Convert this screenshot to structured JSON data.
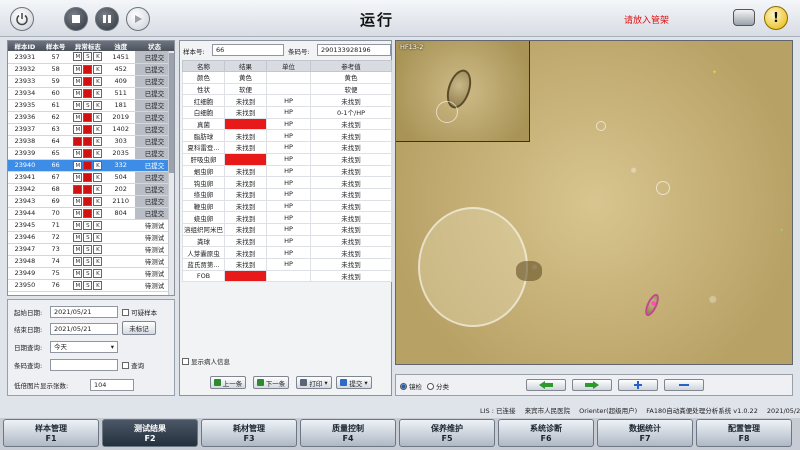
{
  "header": {
    "title": "运行",
    "alert": "请放入管架"
  },
  "samples": {
    "columns": [
      "样本ID",
      "样本号",
      "异常标志",
      "浊度",
      "状态"
    ],
    "rows": [
      {
        "id": "23931",
        "no": "57",
        "flags": [
          "M",
          "S",
          "K"
        ],
        "red": [],
        "turbidity": "1451",
        "status": "已提交"
      },
      {
        "id": "23932",
        "no": "58",
        "flags": [
          "M",
          "S",
          "K"
        ],
        "red": [
          1
        ],
        "turbidity": "452",
        "status": "已提交"
      },
      {
        "id": "23933",
        "no": "59",
        "flags": [
          "M",
          "S",
          "K"
        ],
        "red": [
          1
        ],
        "turbidity": "409",
        "status": "已提交"
      },
      {
        "id": "23934",
        "no": "60",
        "flags": [
          "M",
          "S",
          "K"
        ],
        "red": [
          1
        ],
        "turbidity": "511",
        "status": "已提交"
      },
      {
        "id": "23935",
        "no": "61",
        "flags": [
          "M",
          "S",
          "K"
        ],
        "red": [],
        "turbidity": "181",
        "status": "已提交"
      },
      {
        "id": "23936",
        "no": "62",
        "flags": [
          "M",
          "S",
          "K"
        ],
        "red": [
          1
        ],
        "turbidity": "2019",
        "status": "已提交"
      },
      {
        "id": "23937",
        "no": "63",
        "flags": [
          "M",
          "S",
          "K"
        ],
        "red": [
          1
        ],
        "turbidity": "1402",
        "status": "已提交"
      },
      {
        "id": "23938",
        "no": "64",
        "flags": [
          "M",
          "S",
          "K"
        ],
        "red": [
          0,
          1
        ],
        "turbidity": "303",
        "status": "已提交"
      },
      {
        "id": "23939",
        "no": "65",
        "flags": [
          "M",
          "S",
          "K"
        ],
        "red": [
          1
        ],
        "turbidity": "2035",
        "status": "已提交"
      },
      {
        "id": "23940",
        "no": "66",
        "flags": [
          "M",
          "S",
          "K"
        ],
        "red": [
          1
        ],
        "turbidity": "332",
        "status": "已提交",
        "selected": true
      },
      {
        "id": "23941",
        "no": "67",
        "flags": [
          "M",
          "S",
          "K"
        ],
        "red": [
          1
        ],
        "turbidity": "504",
        "status": "已提交"
      },
      {
        "id": "23942",
        "no": "68",
        "flags": [
          "M",
          "S",
          "K"
        ],
        "red": [
          0,
          1
        ],
        "turbidity": "202",
        "status": "已提交"
      },
      {
        "id": "23943",
        "no": "69",
        "flags": [
          "M",
          "S",
          "K"
        ],
        "red": [
          1
        ],
        "turbidity": "2110",
        "status": "已提交"
      },
      {
        "id": "23944",
        "no": "70",
        "flags": [
          "M",
          "S",
          "K"
        ],
        "red": [
          1
        ],
        "turbidity": "804",
        "status": "已提交"
      },
      {
        "id": "23945",
        "no": "71",
        "flags": [
          "M",
          "S",
          "K"
        ],
        "red": [],
        "turbidity": "",
        "status": "待测试"
      },
      {
        "id": "23946",
        "no": "72",
        "flags": [
          "M",
          "S",
          "K"
        ],
        "red": [],
        "turbidity": "",
        "status": "待测试"
      },
      {
        "id": "23947",
        "no": "73",
        "flags": [
          "M",
          "S",
          "K"
        ],
        "red": [],
        "turbidity": "",
        "status": "待测试"
      },
      {
        "id": "23948",
        "no": "74",
        "flags": [
          "M",
          "S",
          "K"
        ],
        "red": [],
        "turbidity": "",
        "status": "待测试"
      },
      {
        "id": "23949",
        "no": "75",
        "flags": [
          "M",
          "S",
          "K"
        ],
        "red": [],
        "turbidity": "",
        "status": "待测试"
      },
      {
        "id": "23950",
        "no": "76",
        "flags": [
          "M",
          "S",
          "K"
        ],
        "red": [],
        "turbidity": "",
        "status": "待测试"
      }
    ]
  },
  "query": {
    "start_label": "起始日期:",
    "start_value": "2021/05/21",
    "suspicious_label": "可疑样本",
    "end_label": "结束日期:",
    "end_value": "2021/05/21",
    "unmarked_label": "未标记",
    "date_query_label": "日期查询:",
    "date_query_value": "今天",
    "barcode_label": "条码查询:",
    "barcode_value": "",
    "query_label": "查询",
    "min_count_label": "低倍图片显示张数:",
    "min_count_value": "104"
  },
  "result": {
    "sample_no_label": "样本号:",
    "sample_no_value": "66",
    "barcode_label": "条码号:",
    "barcode_value": "290133928196",
    "columns": [
      "名称",
      "结果",
      "单位",
      "参考值"
    ],
    "rows": [
      {
        "name": "颜色",
        "result": "黄色",
        "unit": "",
        "ref": "黄色"
      },
      {
        "name": "性状",
        "result": "软便",
        "unit": "",
        "ref": "软便"
      },
      {
        "name": "红细胞",
        "result": "未找到",
        "unit": "HP",
        "ref": "未找到"
      },
      {
        "name": "白细胞",
        "result": "未找到",
        "unit": "HP",
        "ref": "0-1个/HP"
      },
      {
        "name": "真菌",
        "result": "",
        "unit": "HP",
        "ref": "未找到",
        "red": true
      },
      {
        "name": "脂肪球",
        "result": "未找到",
        "unit": "HP",
        "ref": "未找到"
      },
      {
        "name": "夏科雷登...",
        "result": "未找到",
        "unit": "HP",
        "ref": "未找到"
      },
      {
        "name": "肝吸虫卵",
        "result": "",
        "unit": "HP",
        "ref": "未找到",
        "red": true
      },
      {
        "name": "蛔虫卵",
        "result": "未找到",
        "unit": "HP",
        "ref": "未找到"
      },
      {
        "name": "钩虫卵",
        "result": "未找到",
        "unit": "HP",
        "ref": "未找到"
      },
      {
        "name": "绦虫卵",
        "result": "未找到",
        "unit": "HP",
        "ref": "未找到"
      },
      {
        "name": "鞭虫卵",
        "result": "未找到",
        "unit": "HP",
        "ref": "未找到"
      },
      {
        "name": "蛲虫卵",
        "result": "未找到",
        "unit": "HP",
        "ref": "未找到"
      },
      {
        "name": "溶组织阿米巴",
        "result": "未找到",
        "unit": "HP",
        "ref": "未找到"
      },
      {
        "name": "粪球",
        "result": "未找到",
        "unit": "HP",
        "ref": "未找到"
      },
      {
        "name": "人芽囊原虫",
        "result": "未找到",
        "unit": "HP",
        "ref": "未找到"
      },
      {
        "name": "蓝氏贾第...",
        "result": "未找到",
        "unit": "HP",
        "ref": "未找到"
      },
      {
        "name": "FOB",
        "result": "",
        "unit": "",
        "ref": "未找到",
        "red": true
      }
    ],
    "show_patient_label": "显示病人信息",
    "prev_label": "上一条",
    "next_label": "下一条",
    "print_label": "打印",
    "submit_label": "提交"
  },
  "image": {
    "inset_label": "HF13-2",
    "mode_low_label": "镜检",
    "mode_class_label": "分类"
  },
  "status": {
    "lis": "LIS : 已连接",
    "hospital": "来宾市人民医院",
    "user": "Orienter(超级用户)",
    "system": "FA180自动粪便处理分析系统 v1.0.22",
    "datetime": "2021/05/21  12:58:31"
  },
  "nav": [
    {
      "label": "样本管理",
      "key": "F1"
    },
    {
      "label": "测试结果",
      "key": "F2",
      "active": true
    },
    {
      "label": "耗材管理",
      "key": "F3"
    },
    {
      "label": "质量控制",
      "key": "F4"
    },
    {
      "label": "保养维护",
      "key": "F5"
    },
    {
      "label": "系统诊断",
      "key": "F6"
    },
    {
      "label": "数据统计",
      "key": "F7"
    },
    {
      "label": "配置管理",
      "key": "F8"
    }
  ],
  "colors": {
    "selected_row": "#3d8ce6",
    "alert_red": "#e01010",
    "abnormal_cell": "#e81919"
  }
}
